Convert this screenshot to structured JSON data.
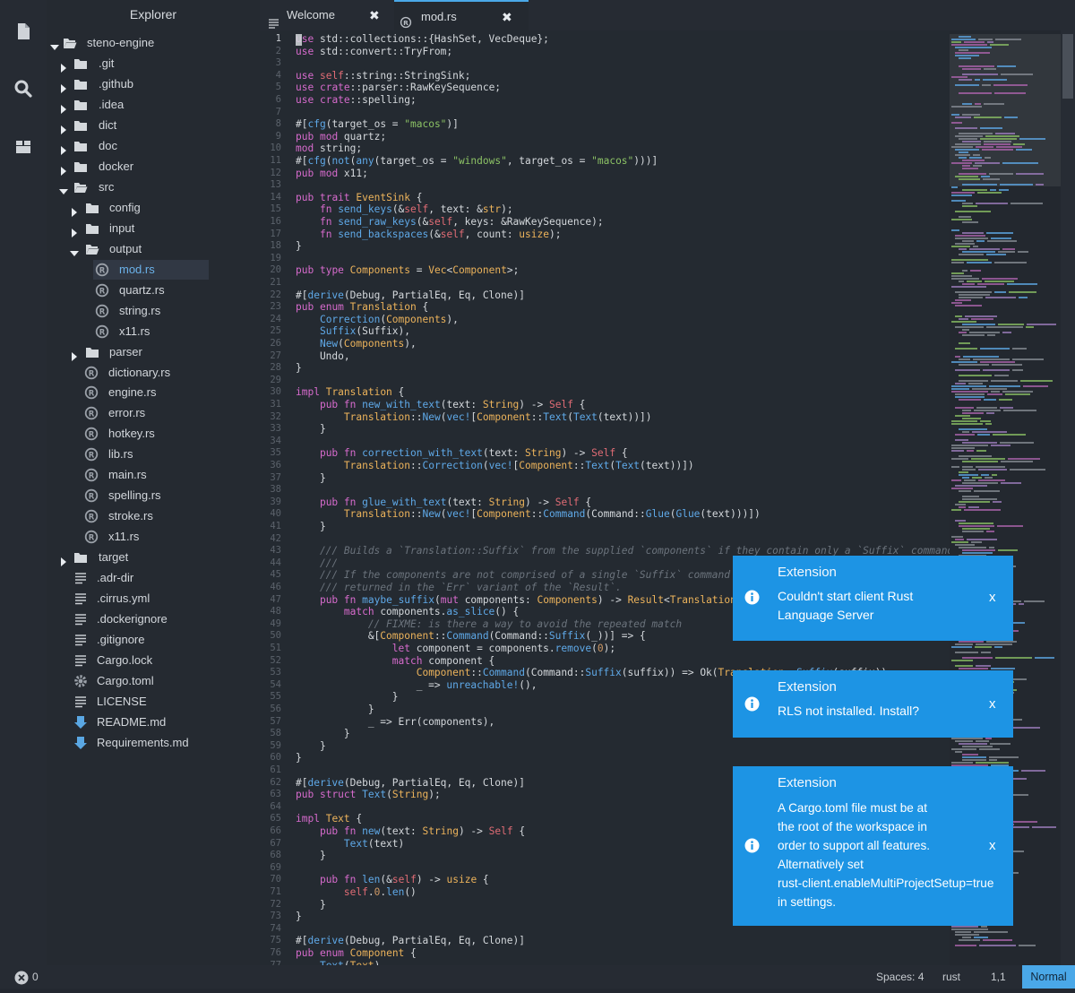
{
  "explorer": {
    "title": "Explorer",
    "items": [
      {
        "label": "steno-engine",
        "type": "folder-open",
        "depth": 0
      },
      {
        "label": ".git",
        "type": "folder",
        "depth": 1
      },
      {
        "label": ".github",
        "type": "folder",
        "depth": 1
      },
      {
        "label": ".idea",
        "type": "folder",
        "depth": 1
      },
      {
        "label": "dict",
        "type": "folder",
        "depth": 1
      },
      {
        "label": "doc",
        "type": "folder",
        "depth": 1
      },
      {
        "label": "docker",
        "type": "folder",
        "depth": 1
      },
      {
        "label": "src",
        "type": "folder-open",
        "depth": 1
      },
      {
        "label": "config",
        "type": "folder",
        "depth": 2
      },
      {
        "label": "input",
        "type": "folder",
        "depth": 2
      },
      {
        "label": "output",
        "type": "folder-open",
        "depth": 2
      },
      {
        "label": "mod.rs",
        "type": "rust",
        "depth": 3,
        "selected": true
      },
      {
        "label": "quartz.rs",
        "type": "rust",
        "depth": 3
      },
      {
        "label": "string.rs",
        "type": "rust",
        "depth": 3
      },
      {
        "label": "x11.rs",
        "type": "rust",
        "depth": 3
      },
      {
        "label": "parser",
        "type": "folder",
        "depth": 2
      },
      {
        "label": "dictionary.rs",
        "type": "rust",
        "depth": 2
      },
      {
        "label": "engine.rs",
        "type": "rust",
        "depth": 2
      },
      {
        "label": "error.rs",
        "type": "rust",
        "depth": 2
      },
      {
        "label": "hotkey.rs",
        "type": "rust",
        "depth": 2
      },
      {
        "label": "lib.rs",
        "type": "rust",
        "depth": 2
      },
      {
        "label": "main.rs",
        "type": "rust",
        "depth": 2
      },
      {
        "label": "spelling.rs",
        "type": "rust",
        "depth": 2
      },
      {
        "label": "stroke.rs",
        "type": "rust",
        "depth": 2
      },
      {
        "label": "x11.rs",
        "type": "rust",
        "depth": 2
      },
      {
        "label": "target",
        "type": "folder",
        "depth": 1
      },
      {
        "label": ".adr-dir",
        "type": "text",
        "depth": 1
      },
      {
        "label": ".cirrus.yml",
        "type": "text",
        "depth": 1
      },
      {
        "label": ".dockerignore",
        "type": "text",
        "depth": 1
      },
      {
        "label": ".gitignore",
        "type": "text",
        "depth": 1
      },
      {
        "label": "Cargo.lock",
        "type": "text",
        "depth": 1
      },
      {
        "label": "Cargo.toml",
        "type": "gear",
        "depth": 1
      },
      {
        "label": "LICENSE",
        "type": "text",
        "depth": 1
      },
      {
        "label": "README.md",
        "type": "markdown",
        "depth": 1
      },
      {
        "label": "Requirements.md",
        "type": "markdown",
        "depth": 1
      }
    ]
  },
  "tabs": [
    {
      "label": "Welcome",
      "icon": "list-icon",
      "close": "✖"
    },
    {
      "label": "mod.rs",
      "icon": "rust-icon",
      "close": "✖",
      "active": true
    }
  ],
  "editor": {
    "start_line": 1,
    "current_line": 1,
    "lines": [
      "use std::collections::{HashSet, VecDeque};",
      "use std::convert::TryFrom;",
      "",
      "use self::string::StringSink;",
      "use crate::parser::RawKeySequence;",
      "use crate::spelling;",
      "",
      "#[cfg(target_os = \"macos\")]",
      "pub mod quartz;",
      "mod string;",
      "#[cfg(not(any(target_os = \"windows\", target_os = \"macos\")))]",
      "pub mod x11;",
      "",
      "pub trait EventSink {",
      "    fn send_keys(&self, text: &str);",
      "    fn send_raw_keys(&self, keys: &RawKeySequence);",
      "    fn send_backspaces(&self, count: usize);",
      "}",
      "",
      "pub type Components = Vec<Component>;",
      "",
      "#[derive(Debug, PartialEq, Eq, Clone)]",
      "pub enum Translation {",
      "    Correction(Components),",
      "    Suffix(Suffix),",
      "    New(Components),",
      "    Undo,",
      "}",
      "",
      "impl Translation {",
      "    pub fn new_with_text(text: String) -> Self {",
      "        Translation::New(vec![Component::Text(Text(text))])",
      "    }",
      "",
      "    pub fn correction_with_text(text: String) -> Self {",
      "        Translation::Correction(vec![Component::Text(Text(text))])",
      "    }",
      "",
      "    pub fn glue_with_text(text: String) -> Self {",
      "        Translation::New(vec![Component::Command(Command::Glue(Glue(text)))])",
      "    }",
      "",
      "    /// Builds a `Translation::Suffix` from the supplied `components` if they contain only a `Suffix` command.",
      "    ///",
      "    /// If the components are not comprised of a single `Suffix` command then",
      "    /// returned in the `Err` variant of the `Result`.",
      "    pub fn maybe_suffix(mut components: Components) -> Result<Translation, Com",
      "        match components.as_slice() {",
      "            // FIXME: is there a way to avoid the repeated match",
      "            &[Component::Command(Command::Suffix(_))] => {",
      "                let component = components.remove(0);",
      "                match component {",
      "                    Component::Command(Command::Suffix(suffix)) => Ok(Translation::Suffix(suffix)),",
      "                    _ => unreachable!(),",
      "                }",
      "            }",
      "            _ => Err(components),",
      "        }",
      "    }",
      "}",
      "",
      "#[derive(Debug, PartialEq, Eq, Clone)]",
      "pub struct Text(String);",
      "",
      "impl Text {",
      "    pub fn new(text: String) -> Self {",
      "        Text(text)",
      "    }",
      "",
      "    pub fn len(&self) -> usize {",
      "        self.0.len()",
      "    }",
      "}",
      "",
      "#[derive(Debug, PartialEq, Eq, Clone)]",
      "pub enum Component {",
      "    Text(Text),"
    ]
  },
  "notifications": [
    {
      "title": "Extension",
      "message": "Couldn't start client Rust\nLanguage Server",
      "close": "x",
      "icon": "info-icon"
    },
    {
      "title": "Extension",
      "message": "RLS not installed. Install?",
      "close": "x",
      "icon": "info-icon"
    },
    {
      "title": "Extension",
      "message": "A Cargo.toml file must be at\nthe root of the workspace in\norder to support all features.\nAlternatively set\nrust-client.enableMultiProjectSetup=true\nin settings.",
      "close": "x",
      "icon": "info-icon"
    }
  ],
  "status": {
    "errors": "0",
    "spaces": "Spaces: 4",
    "language": "rust",
    "position": "1,1",
    "mode": "Normal"
  },
  "colors": {
    "accent": "#4aa8e8",
    "notification": "#1d94e4",
    "background": "#232830"
  }
}
